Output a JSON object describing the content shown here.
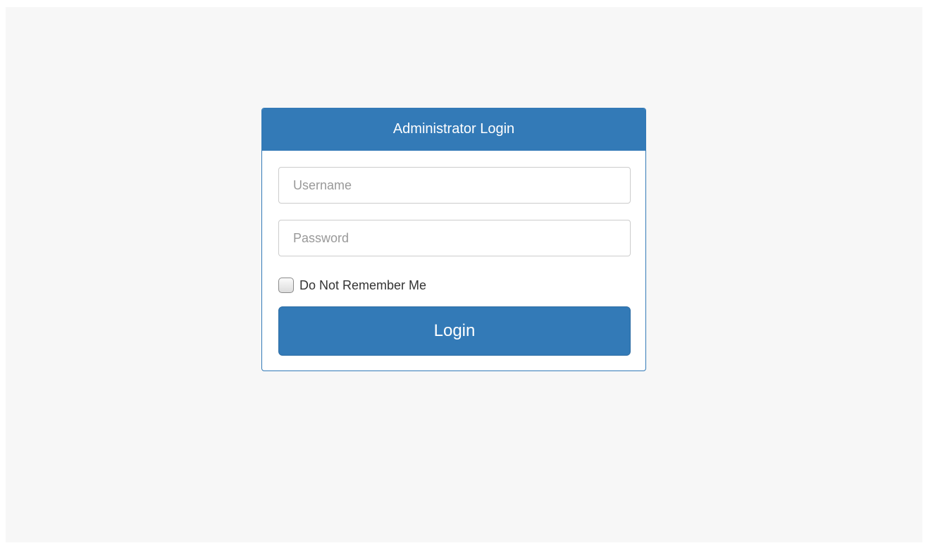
{
  "login_panel": {
    "title": "Administrator Login",
    "username": {
      "placeholder": "Username",
      "value": ""
    },
    "password": {
      "placeholder": "Password",
      "value": ""
    },
    "remember_checkbox": {
      "label": "Do Not Remember Me",
      "checked": false
    },
    "submit_label": "Login"
  },
  "colors": {
    "primary": "#337ab7",
    "background": "#f7f7f7"
  }
}
